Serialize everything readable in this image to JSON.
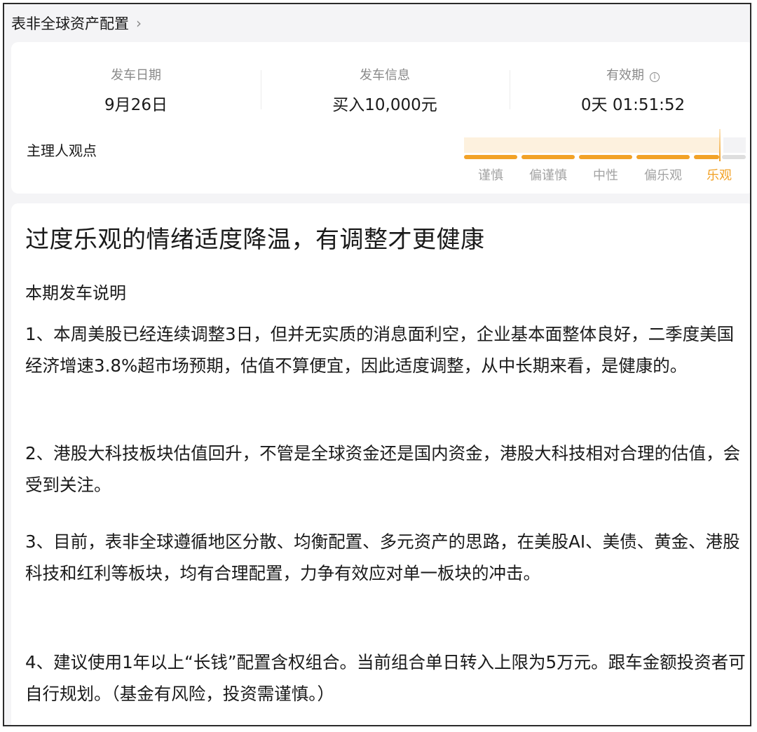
{
  "breadcrumb": {
    "title": "表非全球资产配置",
    "chevron": "›"
  },
  "summary": {
    "depart_date": {
      "label": "发车日期",
      "value": "9月26日"
    },
    "depart_info": {
      "label": "发车信息",
      "value": "买入10,000元"
    },
    "validity": {
      "label": "有效期",
      "value": "0天 01:51:52",
      "info_icon": "info-icon"
    }
  },
  "manager_view": {
    "label": "主理人观点",
    "scale": [
      "谨慎",
      "偏谨慎",
      "中性",
      "偏乐观",
      "乐观"
    ],
    "selected": "乐观",
    "accent_color": "#f2a227"
  },
  "article": {
    "headline": "过度乐观的情绪适度降温，有调整才更健康",
    "section_title": "本期发车说明",
    "paragraphs": [
      "1、本周美股已经连续调整3日，但并无实质的消息面利空，企业基本面整体良好，二季度美国经济增速3.8%超市场预期，估值不算便宜，因此适度调整，从中长期来看，是健康的。",
      "2、港股大科技板块估值回升，不管是全球资金还是国内资金，港股大科技相对合理的估值，会受到关注。",
      "3、目前，表非全球遵循地区分散、均衡配置、多元资产的思路，在美股AI、美债、黄金、港股科技和红利等板块，均有合理配置，力争有效应对单一板块的冲击。",
      "4、建议使用1年以上“长钱”配置含权组合。当前组合单日转入上限为5万元。跟车金额投资者可自行规划。（基金有风险，投资需谨慎。）"
    ]
  }
}
